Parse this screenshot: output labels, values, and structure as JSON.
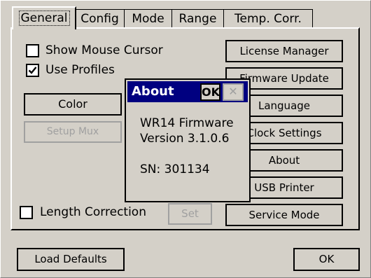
{
  "tabs": [
    "General",
    "Config",
    "Mode",
    "Range",
    "Temp. Corr."
  ],
  "general": {
    "show_mouse_cursor": {
      "label": "Show Mouse Cursor",
      "checked": false
    },
    "use_profiles": {
      "label": "Use Profiles",
      "checked": true
    },
    "color_button": "Color",
    "setup_mux_button": "Setup Mux",
    "length_correction": {
      "label": "Length Correction",
      "checked": false
    },
    "set_button": "Set",
    "right_buttons": [
      "License Manager",
      "Firmware Update",
      "Language",
      "Clock Settings",
      "About",
      "USB Printer",
      "Service Mode"
    ]
  },
  "footer": {
    "load_defaults": "Load Defaults",
    "ok": "OK"
  },
  "about_dialog": {
    "title": "About",
    "ok": "OK",
    "close_glyph": "✕",
    "product": "WR14 Firmware",
    "version": "Version 3.1.0.6",
    "serial": "SN: 301134"
  },
  "colors": {
    "title_bar": "#000080",
    "face": "#d4d0c8"
  }
}
